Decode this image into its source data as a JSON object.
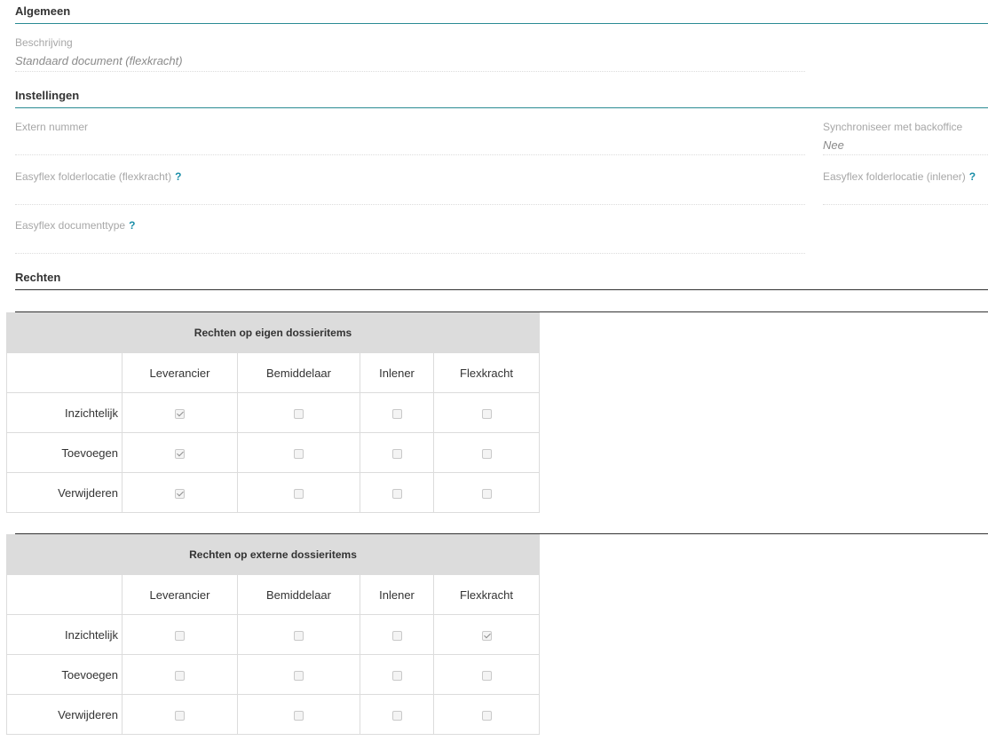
{
  "algemeen": {
    "title": "Algemeen",
    "beschrijving": {
      "label": "Beschrijving",
      "value": "Standaard document (flexkracht)"
    }
  },
  "instellingen": {
    "title": "Instellingen",
    "extern_nummer": {
      "label": "Extern nummer",
      "value": ""
    },
    "synchroniseer": {
      "label": "Synchroniseer met backoffice",
      "value": "Nee"
    },
    "folder_flexkracht": {
      "label": "Easyflex folderlocatie (flexkracht)",
      "help": "?"
    },
    "folder_inlener": {
      "label": "Easyflex folderlocatie (inlener)",
      "help": "?"
    },
    "documenttype": {
      "label": "Easyflex documenttype",
      "help": "?"
    }
  },
  "rechten": {
    "title": "Rechten",
    "columns": [
      "Leverancier",
      "Bemiddelaar",
      "Inlener",
      "Flexkracht"
    ],
    "rows": [
      "Inzichtelijk",
      "Toevoegen",
      "Verwijderen"
    ],
    "eigen": {
      "title": "Rechten op eigen dossieritems",
      "checked": [
        [
          true,
          false,
          false,
          false
        ],
        [
          true,
          false,
          false,
          false
        ],
        [
          true,
          false,
          false,
          false
        ]
      ]
    },
    "extern": {
      "title": "Rechten op externe dossieritems",
      "checked": [
        [
          false,
          false,
          false,
          true
        ],
        [
          false,
          false,
          false,
          false
        ],
        [
          false,
          false,
          false,
          false
        ]
      ]
    }
  }
}
